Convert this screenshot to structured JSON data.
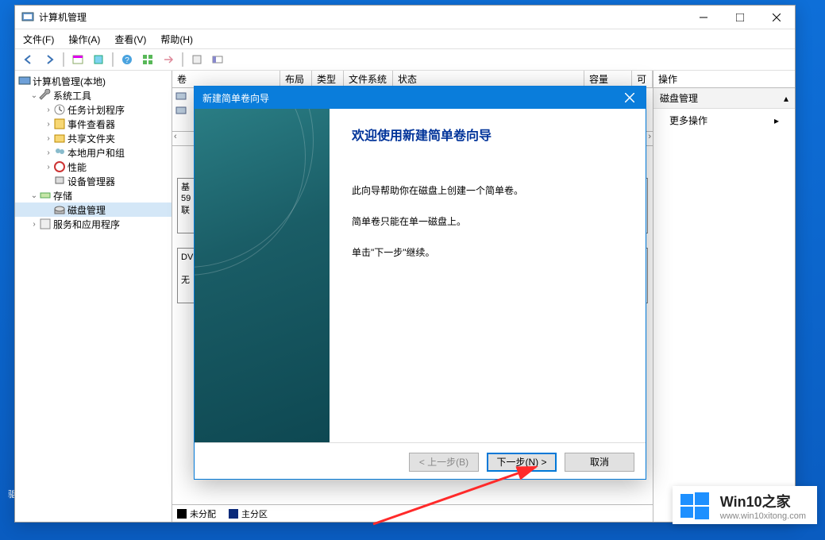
{
  "window": {
    "title": "计算机管理"
  },
  "menu": {
    "file": "文件(F)",
    "action": "操作(A)",
    "view": "查看(V)",
    "help": "帮助(H)"
  },
  "tree": {
    "root": "计算机管理(本地)",
    "systools": "系统工具",
    "scheduler": "任务计划程序",
    "eventviewer": "事件查看器",
    "shared": "共享文件夹",
    "users": "本地用户和组",
    "perf": "性能",
    "devmgr": "设备管理器",
    "storage": "存储",
    "diskmgmt": "磁盘管理",
    "services": "服务和应用程序"
  },
  "list": {
    "cols": {
      "volume": "卷",
      "layout": "布局",
      "type": "类型",
      "fs": "文件系统",
      "status": "状态",
      "capacity": "容量",
      "free": "可"
    }
  },
  "disk": {
    "basic_prefix": "基",
    "size_prefix": "59",
    "online_prefix": "联",
    "dvd_prefix": "DV",
    "nomedia_prefix": "无"
  },
  "legend": {
    "unallocated": "未分配",
    "primary": "主分区"
  },
  "actions": {
    "header": "操作",
    "section": "磁盘管理",
    "more": "更多操作"
  },
  "wizard": {
    "title": "新建简单卷向导",
    "heading": "欢迎使用新建简单卷向导",
    "p1": "此向导帮助你在磁盘上创建一个简单卷。",
    "p2": "简单卷只能在单一磁盘上。",
    "p3": "单击\"下一步\"继续。",
    "back": "< 上一步(B)",
    "next": "下一步(N) >",
    "cancel": "取消"
  },
  "desktop": {
    "drive": "驱"
  },
  "watermark": {
    "title": "Win10之家",
    "url": "www.win10xitong.com"
  }
}
